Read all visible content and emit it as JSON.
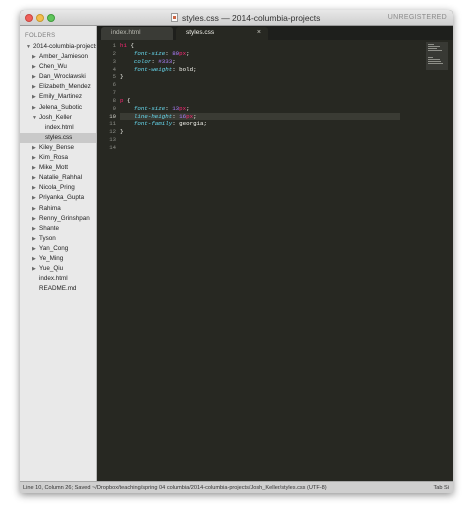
{
  "window": {
    "title": "styles.css — 2014-columbia-projects",
    "unregistered_label": "UNREGISTERED"
  },
  "sidebar": {
    "header": "FOLDERS",
    "root": "2014-columbia-projects",
    "items": [
      {
        "label": "Amber_Jamieson",
        "type": "folder",
        "level": 1,
        "expanded": false
      },
      {
        "label": "Chen_Wu",
        "type": "folder",
        "level": 1,
        "expanded": false
      },
      {
        "label": "Dan_Wroclawski",
        "type": "folder",
        "level": 1,
        "expanded": false
      },
      {
        "label": "Elizabeth_Mendez",
        "type": "folder",
        "level": 1,
        "expanded": false
      },
      {
        "label": "Emily_Martinez",
        "type": "folder",
        "level": 1,
        "expanded": false
      },
      {
        "label": "Jelena_Subotic",
        "type": "folder",
        "level": 1,
        "expanded": false
      },
      {
        "label": "Josh_Keller",
        "type": "folder",
        "level": 1,
        "expanded": true
      },
      {
        "label": "index.html",
        "type": "file",
        "level": 2
      },
      {
        "label": "styles.css",
        "type": "file",
        "level": 2,
        "selected": true
      },
      {
        "label": "Kiley_Bense",
        "type": "folder",
        "level": 1,
        "expanded": false
      },
      {
        "label": "Kim_Rosa",
        "type": "folder",
        "level": 1,
        "expanded": false
      },
      {
        "label": "Mike_Mott",
        "type": "folder",
        "level": 1,
        "expanded": false
      },
      {
        "label": "Natalie_Rahhal",
        "type": "folder",
        "level": 1,
        "expanded": false
      },
      {
        "label": "Nicola_Pring",
        "type": "folder",
        "level": 1,
        "expanded": false
      },
      {
        "label": "Priyanka_Gupta",
        "type": "folder",
        "level": 1,
        "expanded": false
      },
      {
        "label": "Rahima",
        "type": "folder",
        "level": 1,
        "expanded": false
      },
      {
        "label": "Renny_Grinshpan",
        "type": "folder",
        "level": 1,
        "expanded": false
      },
      {
        "label": "Shante",
        "type": "folder",
        "level": 1,
        "expanded": false
      },
      {
        "label": "Tyson",
        "type": "folder",
        "level": 1,
        "expanded": false
      },
      {
        "label": "Yan_Cong",
        "type": "folder",
        "level": 1,
        "expanded": false
      },
      {
        "label": "Ye_Ming",
        "type": "folder",
        "level": 1,
        "expanded": false
      },
      {
        "label": "Yue_Qiu",
        "type": "folder",
        "level": 1,
        "expanded": false
      },
      {
        "label": "index.html",
        "type": "file",
        "level": 1
      },
      {
        "label": "README.md",
        "type": "file",
        "level": 1
      }
    ]
  },
  "tabs": [
    {
      "label": "index.html",
      "active": false
    },
    {
      "label": "styles.css",
      "active": true,
      "close": "×"
    }
  ],
  "editor": {
    "current_line": 10,
    "lines": [
      [
        {
          "t": "h1",
          "c": "sel"
        },
        {
          "t": " {",
          "c": "pn"
        }
      ],
      [
        {
          "t": "    ",
          "c": "pn"
        },
        {
          "t": "font-size",
          "c": "prop"
        },
        {
          "t": ": ",
          "c": "pn"
        },
        {
          "t": "80",
          "c": "num"
        },
        {
          "t": "px",
          "c": "unit"
        },
        {
          "t": ";",
          "c": "pn"
        }
      ],
      [
        {
          "t": "    ",
          "c": "pn"
        },
        {
          "t": "color",
          "c": "prop"
        },
        {
          "t": ": ",
          "c": "pn"
        },
        {
          "t": "#333",
          "c": "num"
        },
        {
          "t": ";",
          "c": "pn"
        }
      ],
      [
        {
          "t": "    ",
          "c": "pn"
        },
        {
          "t": "font-weight",
          "c": "prop"
        },
        {
          "t": ": bold;",
          "c": "pn"
        }
      ],
      [
        {
          "t": "}",
          "c": "pn"
        }
      ],
      [],
      [],
      [
        {
          "t": "p",
          "c": "sel"
        },
        {
          "t": " {",
          "c": "pn"
        }
      ],
      [
        {
          "t": "    ",
          "c": "pn"
        },
        {
          "t": "font-size",
          "c": "prop"
        },
        {
          "t": ": ",
          "c": "pn"
        },
        {
          "t": "13",
          "c": "num"
        },
        {
          "t": "px",
          "c": "unit"
        },
        {
          "t": ";",
          "c": "pn"
        }
      ],
      [
        {
          "t": "    ",
          "c": "pn"
        },
        {
          "t": "line-height",
          "c": "prop"
        },
        {
          "t": ": ",
          "c": "pn"
        },
        {
          "t": "16",
          "c": "num"
        },
        {
          "t": "px",
          "c": "unit"
        },
        {
          "t": ";",
          "c": "pn"
        }
      ],
      [
        {
          "t": "    ",
          "c": "pn"
        },
        {
          "t": "font-family",
          "c": "prop"
        },
        {
          "t": ": georgia;",
          "c": "pn"
        }
      ],
      [
        {
          "t": "}",
          "c": "pn"
        }
      ],
      [],
      []
    ]
  },
  "statusbar": {
    "text": "Line 10, Column 26; Saved ~/Dropbox/teaching/spring 04 columbia/2014-columbia-projects/Josh_Keller/styles.css (UTF-8)",
    "right": "Tab Si"
  },
  "colors": {
    "editor_bg": "#272822",
    "selector": "#f92672",
    "property": "#66d9ef",
    "number": "#ae81ff",
    "sidebar_bg": "#e9e9e9"
  }
}
